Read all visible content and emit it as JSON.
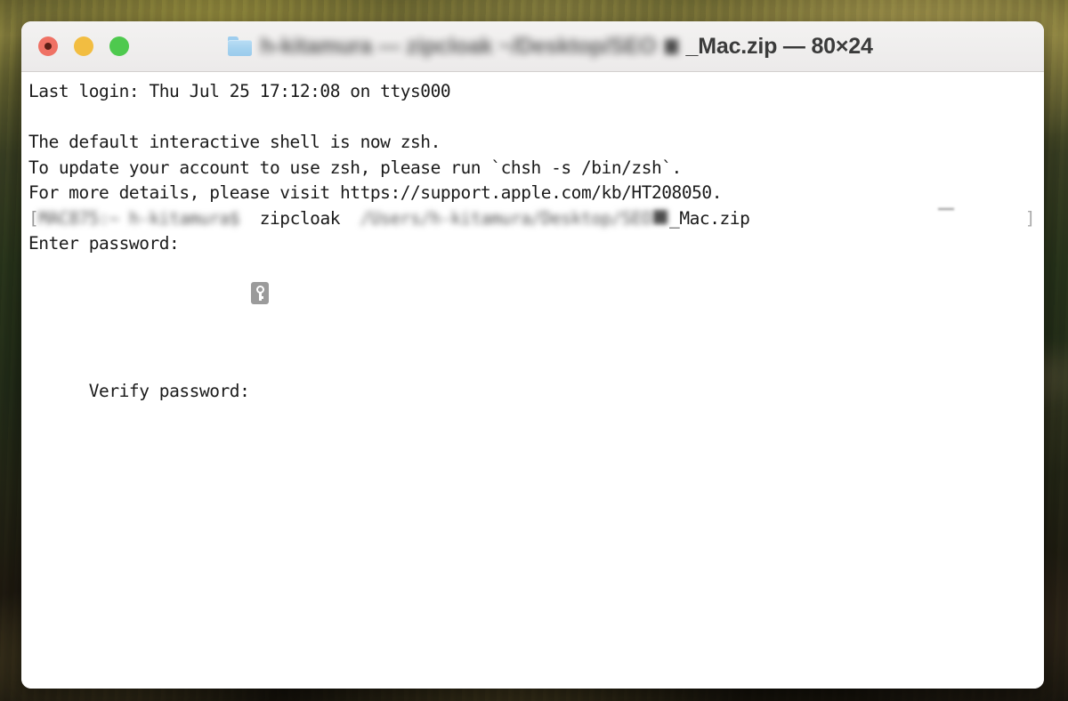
{
  "window": {
    "title_blurred_prefix": "h-kitamura — zipcloak ~/Desktop/SEO",
    "title_visible_suffix": "_Mac.zip — 80×24",
    "title_size": "80×24",
    "folder_icon": "folder-icon",
    "traffic_lights": [
      {
        "name": "close",
        "label": "Close",
        "color": "#ef7164"
      },
      {
        "name": "minimize",
        "label": "Minimize",
        "color": "#f2bd41"
      },
      {
        "name": "maximize",
        "label": "Zoom",
        "color": "#4ec94e"
      }
    ]
  },
  "terminal": {
    "lines": [
      {
        "id": "last-login",
        "text": "Last login: Thu Jul 25 17:12:08 on ttys000"
      },
      {
        "id": "blank-1",
        "text": " "
      },
      {
        "id": "zsh-notice-1",
        "text": "The default interactive shell is now zsh."
      },
      {
        "id": "zsh-notice-2",
        "text": "To update your account to use zsh, please run `chsh -s /bin/zsh`."
      },
      {
        "id": "zsh-notice-3",
        "text": "For more details, please visit https://support.apple.com/kb/HT208050."
      }
    ],
    "prompt": {
      "open_bracket": "[",
      "blurred_prompt": "MAC875:~ h-kitamura$",
      "command": "zipcloak",
      "blurred_path": "/Users/h-kitamura/Desktop/SEO",
      "visible_path_suffix": "_Mac.zip",
      "close_bracket": "]"
    },
    "password_prompts": [
      {
        "id": "enter-password",
        "text": "Enter password:"
      },
      {
        "id": "verify-password",
        "text": "Verify password:"
      }
    ],
    "cursor_icon": "key-icon",
    "background_color": "#ffffff",
    "text_color": "#1a1a1a"
  }
}
